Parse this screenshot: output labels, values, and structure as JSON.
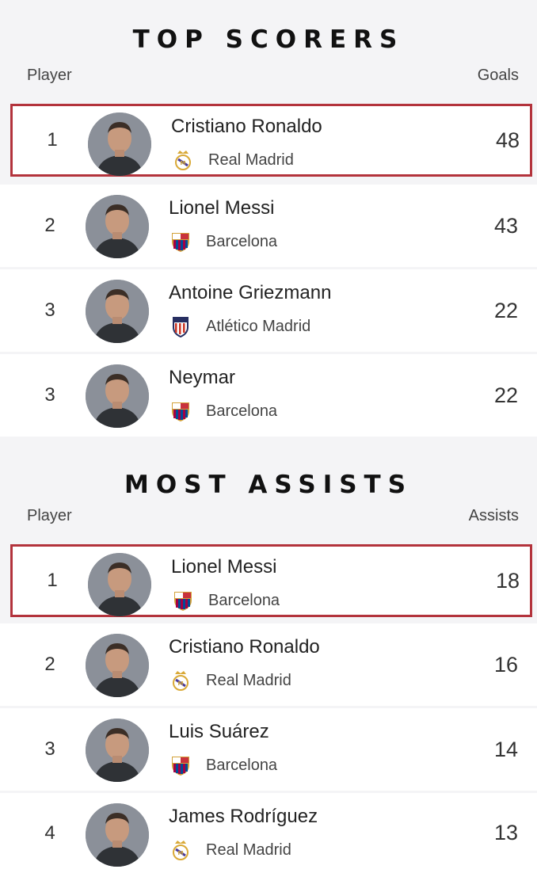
{
  "top_scorers": {
    "title": "TOP SCORERS",
    "player_label": "Player",
    "stat_label": "Goals",
    "rows": [
      {
        "rank": "1",
        "name": "Cristiano Ronaldo",
        "team": "Real Madrid",
        "crest": "real-madrid-crest-icon",
        "value": "48",
        "highlighted": true
      },
      {
        "rank": "2",
        "name": "Lionel Messi",
        "team": "Barcelona",
        "crest": "barcelona-crest-icon",
        "value": "43",
        "highlighted": false
      },
      {
        "rank": "3",
        "name": "Antoine Griezmann",
        "team": "Atlético Madrid",
        "crest": "atletico-crest-icon",
        "value": "22",
        "highlighted": false
      },
      {
        "rank": "3",
        "name": "Neymar",
        "team": "Barcelona",
        "crest": "barcelona-crest-icon",
        "value": "22",
        "highlighted": false
      }
    ]
  },
  "most_assists": {
    "title": "MOST ASSISTS",
    "player_label": "Player",
    "stat_label": "Assists",
    "rows": [
      {
        "rank": "1",
        "name": "Lionel Messi",
        "team": "Barcelona",
        "crest": "barcelona-crest-icon",
        "value": "18",
        "highlighted": true
      },
      {
        "rank": "2",
        "name": "Cristiano Ronaldo",
        "team": "Real Madrid",
        "crest": "real-madrid-crest-icon",
        "value": "16",
        "highlighted": false
      },
      {
        "rank": "3",
        "name": "Luis Suárez",
        "team": "Barcelona",
        "crest": "barcelona-crest-icon",
        "value": "14",
        "highlighted": false
      },
      {
        "rank": "4",
        "name": "James Rodríguez",
        "team": "Real Madrid",
        "crest": "real-madrid-crest-icon",
        "value": "13",
        "highlighted": false
      }
    ]
  },
  "colors": {
    "highlight_border": "#b3333c",
    "page_background": "#f4f4f6",
    "row_background": "#ffffff"
  }
}
